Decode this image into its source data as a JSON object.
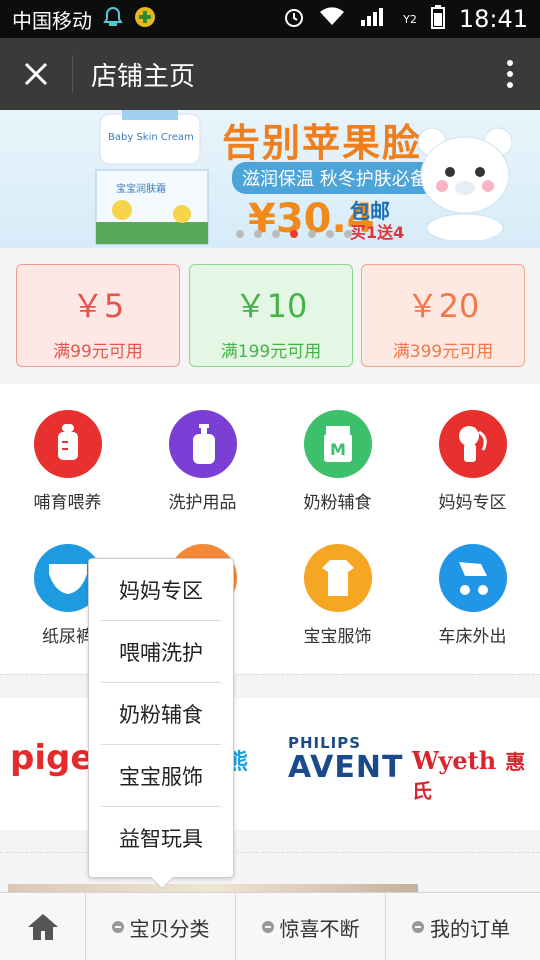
{
  "status_bar": {
    "carrier": "中国移动",
    "network_small": "Y2",
    "time": "18:41"
  },
  "nav": {
    "title": "店铺主页"
  },
  "banner": {
    "headline": "告别苹果脸",
    "subline": "滋润保温 秋冬护肤必备",
    "price": "¥30.4",
    "shipping": "包邮",
    "promo": "买1送4",
    "product_text": "Baby Skin Cream",
    "product_name": "宝宝润肤霜",
    "slide_index": 3,
    "slide_count": 7
  },
  "coupons": [
    {
      "amount": "￥5",
      "condition": "满99元可用"
    },
    {
      "amount": "￥10",
      "condition": "满199元可用"
    },
    {
      "amount": "￥20",
      "condition": "满399元可用"
    }
  ],
  "categories": [
    {
      "label": "哺育喂养",
      "icon": "baby-bottle-icon",
      "color": "#e8302f"
    },
    {
      "label": "洗护用品",
      "icon": "lotion-bottle-icon",
      "color": "#7b3fd6"
    },
    {
      "label": "奶粉辅食",
      "icon": "milk-powder-icon",
      "color": "#3cc06b"
    },
    {
      "label": "妈妈专区",
      "icon": "breast-pump-icon",
      "color": "#e8302f"
    },
    {
      "label": "纸尿裤",
      "icon": "diaper-icon",
      "color": "#1e9be0"
    },
    {
      "label": "",
      "icon": "toy-icon",
      "color": "#f5893a"
    },
    {
      "label": "宝宝服饰",
      "icon": "baby-clothes-icon",
      "color": "#f5a623"
    },
    {
      "label": "车床外出",
      "icon": "stroller-icon",
      "color": "#2196e6"
    }
  ],
  "brands": [
    {
      "name": "pigeo",
      "color": "#e32b2b"
    },
    {
      "name": "熊",
      "color": "#1b9fe0"
    },
    {
      "name_top": "PHILIPS",
      "name": "AVENT",
      "color": "#1a4a8a"
    },
    {
      "name": "Wyeth",
      "name_cn": "惠氏",
      "color": "#d8262e"
    }
  ],
  "popup_menu": {
    "items": [
      "妈妈专区",
      "喂哺洗护",
      "奶粉辅食",
      "宝宝服饰",
      "益智玩具"
    ]
  },
  "tabbar": {
    "home_icon": "home-icon",
    "tabs": [
      "宝贝分类",
      "惊喜不断",
      "我的订单"
    ]
  },
  "colors": {
    "nav_bg": "#3a3a3a",
    "accent_red": "#e63b2e"
  }
}
